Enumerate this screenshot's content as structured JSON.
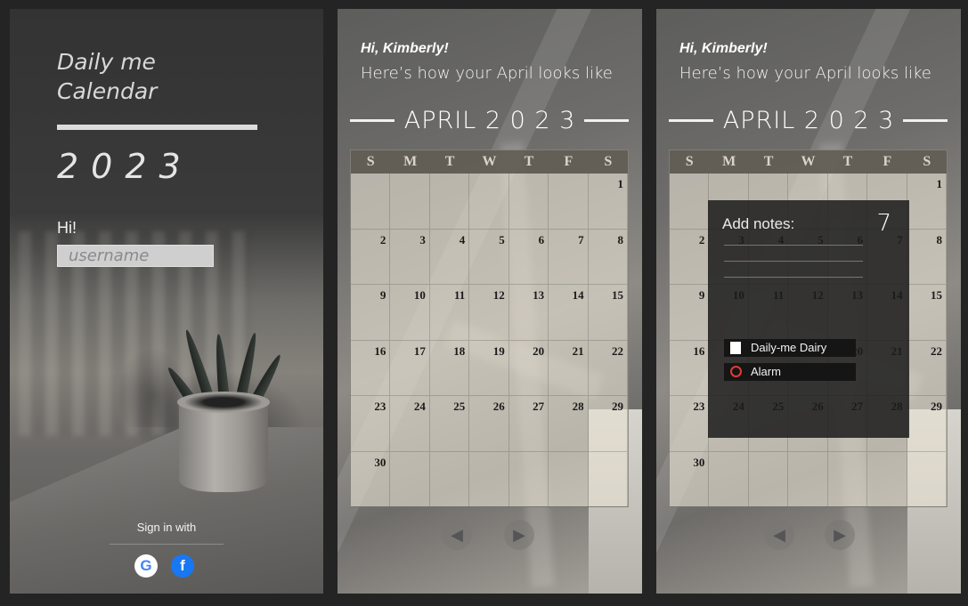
{
  "login": {
    "title_line1": "Daily me",
    "title_line2": "Calendar",
    "year": "2023",
    "hi": "Hi!",
    "username_placeholder": "username",
    "sign_in_with": "Sign in with",
    "google_icon": "G",
    "facebook_icon": "f"
  },
  "calendar": {
    "greeting": "Hi, Kimberly!",
    "subtitle": "Here’s how your April looks like",
    "month": "APRIL 2 0 2 3",
    "weekdays": [
      "S",
      "M",
      "T",
      "W",
      "T",
      "F",
      "S"
    ],
    "days": [
      "",
      "",
      "",
      "",
      "",
      "",
      "1",
      "2",
      "3",
      "4",
      "5",
      "6",
      "7",
      "8",
      "9",
      "10",
      "11",
      "12",
      "13",
      "14",
      "15",
      "16",
      "17",
      "18",
      "19",
      "20",
      "21",
      "22",
      "23",
      "24",
      "25",
      "26",
      "27",
      "28",
      "29",
      "30",
      "",
      "",
      "",
      "",
      "",
      ""
    ],
    "prev_icon": "◀",
    "next_icon": "▶"
  },
  "notes": {
    "label": "Add notes:",
    "day": "7",
    "items": [
      "Daily-me Dairy",
      "Alarm"
    ]
  }
}
